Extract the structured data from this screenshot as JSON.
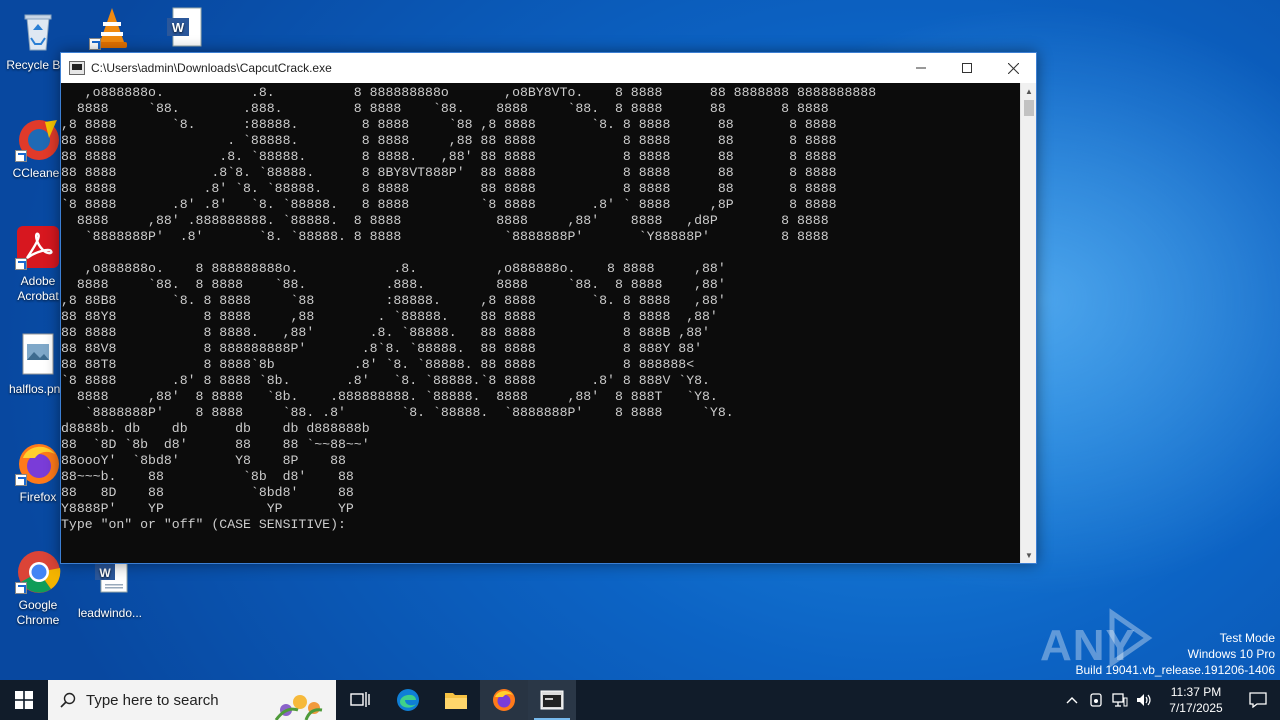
{
  "desktop": {
    "icons": [
      {
        "label": "Recycle Bin"
      },
      {
        "label": ""
      },
      {
        "label": ""
      },
      {
        "label": "CCleaner"
      },
      {
        "label": "Adobe Acrobat"
      },
      {
        "label": "halflos.png"
      },
      {
        "label": "Firefox"
      },
      {
        "label": "Google Chrome"
      },
      {
        "label": "leadwindo..."
      }
    ]
  },
  "console": {
    "title": "C:\\Users\\admin\\Downloads\\CapcutCrack.exe",
    "minimize_icon": "minimize-icon",
    "maximize_icon": "maximize-icon",
    "close_icon": "close-icon",
    "output": "   ,o888888o.           .8.          8 888888888o       ,o8BY8VTo.    8 8888      88 8888888 8888888888\n  8888     `88.        .888.         8 8888    `88.    8888     `88.  8 8888      88       8 8888\n,8 8888       `8.      :88888.        8 8888     `88 ,8 8888       `8. 8 8888      88       8 8888\n88 8888              . `88888.        8 8888     ,88 88 8888           8 8888      88       8 8888\n88 8888             .8. `88888.       8 8888.   ,88' 88 8888           8 8888      88       8 8888\n88 8888            .8`8. `88888.      8 8BY8VT888P'  88 8888           8 8888      88       8 8888\n88 8888           .8' `8. `88888.     8 8888         88 8888           8 8888      88       8 8888\n`8 8888       .8' .8'   `8. `88888.   8 8888         `8 8888       .8' ` 8888     ,8P       8 8888\n  8888     ,88' .888888888. `88888.  8 8888            8888     ,88'    8888   ,d8P        8 8888\n   `8888888P'  .8'       `8. `88888. 8 8888             `8888888P'       `Y88888P'         8 8888\n\n   ,o888888o.    8 888888888o.            .8.          ,o888888o.    8 8888     ,88'\n  8888     `88.  8 8888    `88.          .888.         8888     `88.  8 8888    ,88'\n,8 88B8       `8. 8 8888     `88         :88888.     ,8 8888       `8. 8 8888   ,88'\n88 88Y8           8 8888     ,88        . `88888.    88 8888           8 8888  ,88'\n88 8888           8 8888.   ,88'       .8. `88888.   88 8888           8 888B ,88'\n88 88V8           8 888888888P'       .8`8. `88888.  88 8888           8 888Y 88'\n88 88T8           8 8888`8b          .8' `8. `88888. 88 8888           8 888888<\n`8 8888       .8' 8 8888 `8b.       .8'   `8. `88888.`8 8888       .8' 8 888V `Y8.\n  8888     ,88'  8 8888   `8b.    .888888888. `88888.  8888     ,88'  8 888T   `Y8.\n   `8888888P'    8 8888     `88. .8'       `8. `88888.  `8888888P'    8 8888     `Y8.\nd8888b. db    db      db    db d888888b\n88  `8D `8b  d8'      88    88 `~~88~~'\n88oooY'  `8bd8'       Y8    8P    88\n88~~~b.    88          `8b  d8'    88\n88   8D    88           `8bd8'     88\nY8888P'    YP             YP       YP\nType \"on\" or \"off\" (CASE SENSITIVE):"
  },
  "watermark": {
    "text": "ANY RUN"
  },
  "test_mode": {
    "line1": "Test Mode",
    "line2": "Windows 10 Pro",
    "line3": "Build 19041.vb_release.191206-1406"
  },
  "taskbar": {
    "search_placeholder": "Type here to search",
    "clock_time": "11:37 PM",
    "clock_date": "7/17/2025"
  },
  "colors": {
    "desktop_blue": "#0c63c4",
    "console_bg": "#0c0c0c",
    "console_text": "#cccccc",
    "taskbar": "#111c2a"
  }
}
